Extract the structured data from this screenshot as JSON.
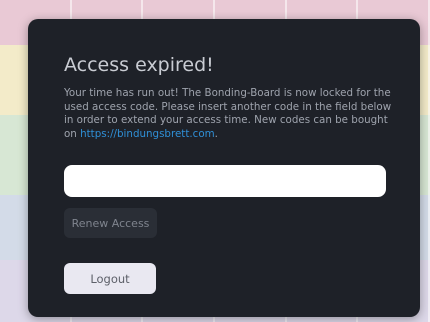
{
  "modal": {
    "title": "Access expired!",
    "message_text": "Your time has run out! The Bonding-Board is now locked for the used access code. Please insert another code in the field below in order to extend your access time. New codes can be bought on ",
    "link_text": "https://bindungsbrett.com",
    "message_end": ".",
    "code_input": {
      "value": "",
      "placeholder": ""
    },
    "renew_label": "Renew Access",
    "logout_label": "Logout"
  },
  "colors": {
    "modal_background": "#1e2128",
    "link": "#2f8fd6",
    "input_background": "#ffffff",
    "renew_background": "#2a2e36",
    "logout_background": "#e9e8f1"
  }
}
